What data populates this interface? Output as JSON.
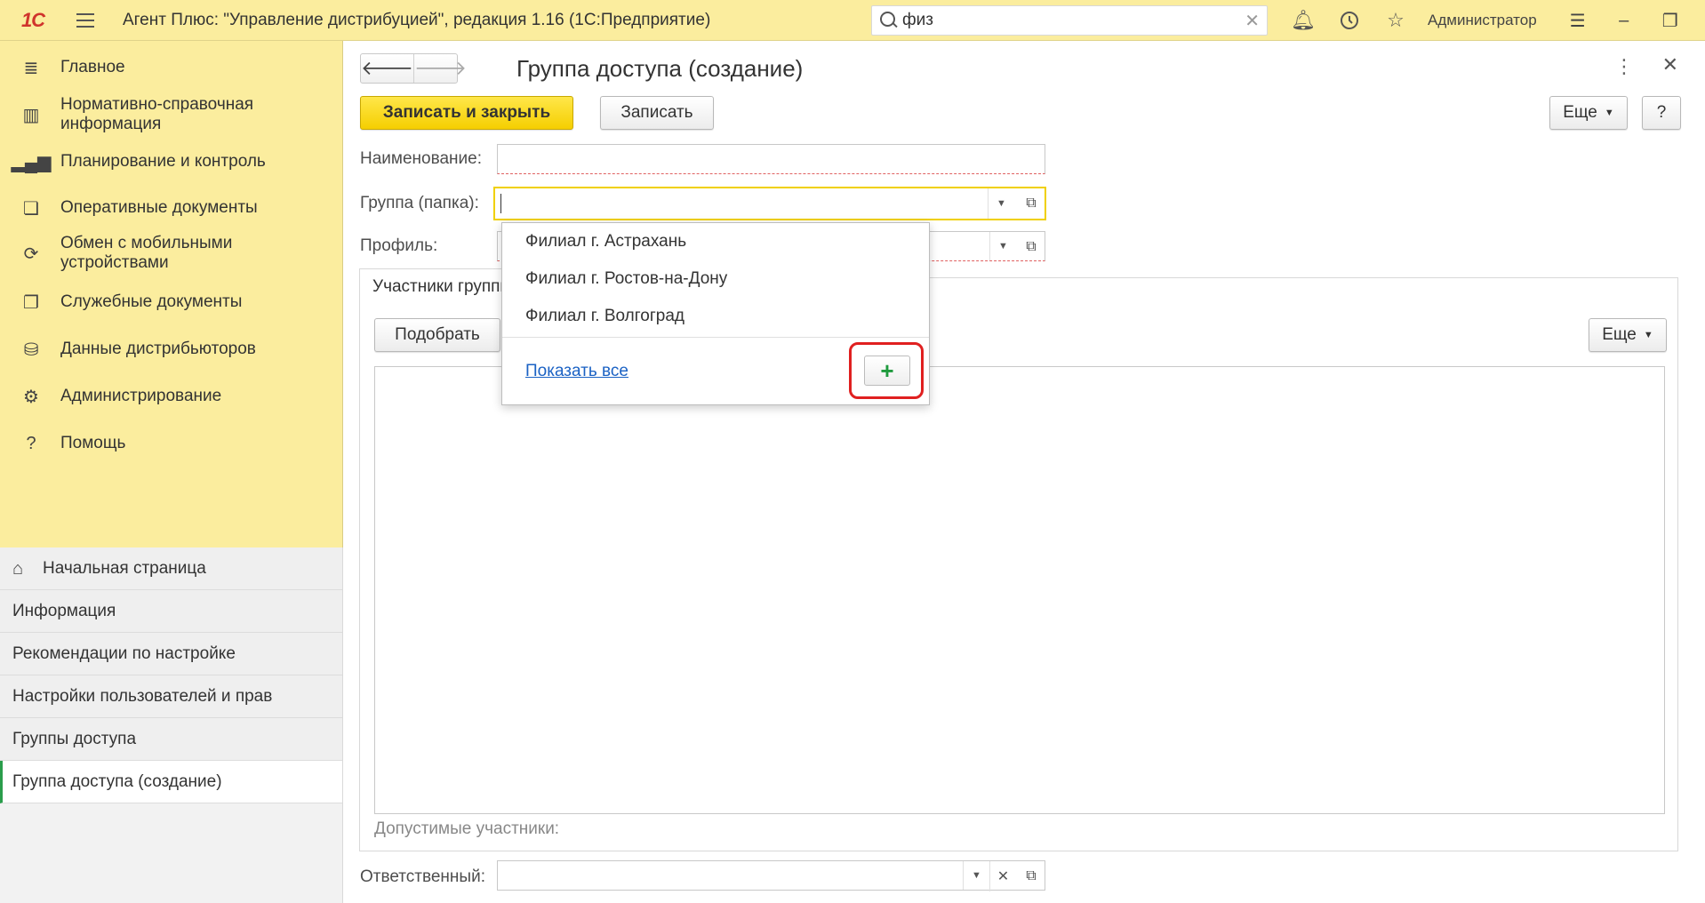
{
  "topbar": {
    "logo": "1С",
    "title": "Агент Плюс: \"Управление дистрибуцией\", редакция 1.16  (1С:Предприятие)",
    "search_value": "физ",
    "user": "Администратор"
  },
  "sidebar": {
    "sections": [
      {
        "label": "Главное",
        "icon": "menu-icon"
      },
      {
        "label": "Нормативно-справочная информация",
        "icon": "books-icon"
      },
      {
        "label": "Планирование и контроль",
        "icon": "chart-icon"
      },
      {
        "label": "Оперативные документы",
        "icon": "documents-icon"
      },
      {
        "label": "Обмен с мобильными устройствами",
        "icon": "sync-icon"
      },
      {
        "label": "Служебные документы",
        "icon": "service-docs-icon"
      },
      {
        "label": "Данные дистрибьюторов",
        "icon": "distributor-data-icon"
      },
      {
        "label": "Администрирование",
        "icon": "gear-icon"
      },
      {
        "label": "Помощь",
        "icon": "help-icon"
      }
    ],
    "open_windows": [
      "Начальная страница",
      "Информация",
      "Рекомендации по настройке",
      "Настройки пользователей и прав",
      "Группы доступа",
      "Группа доступа (создание)"
    ]
  },
  "form": {
    "title": "Группа доступа (создание)",
    "save_close_label": "Записать и закрыть",
    "save_label": "Записать",
    "more_label": "Еще",
    "help_label": "?",
    "name_label": "Наименование:",
    "name_value": "",
    "group_label": "Группа (папка):",
    "group_value": "",
    "profile_label": "Профиль:",
    "members_tab": "Участники группы",
    "pick_label": "Подобрать",
    "members_more_label": "Еще",
    "allowed_hint": "Допустимые участники:",
    "responsible_label": "Ответственный:",
    "responsible_value": ""
  },
  "popup": {
    "items": [
      "Филиал г. Астрахань",
      "Филиал г. Ростов-на-Дону",
      "Филиал г. Волгоград"
    ],
    "show_all": "Показать все",
    "create_icon": "plus-icon"
  },
  "colors": {
    "accent_yellow": "#fbed9e",
    "primary_button": "#f5cf00",
    "highlight_red": "#e02020",
    "plus_green": "#1e9a3d",
    "link_blue": "#1b62c4"
  }
}
